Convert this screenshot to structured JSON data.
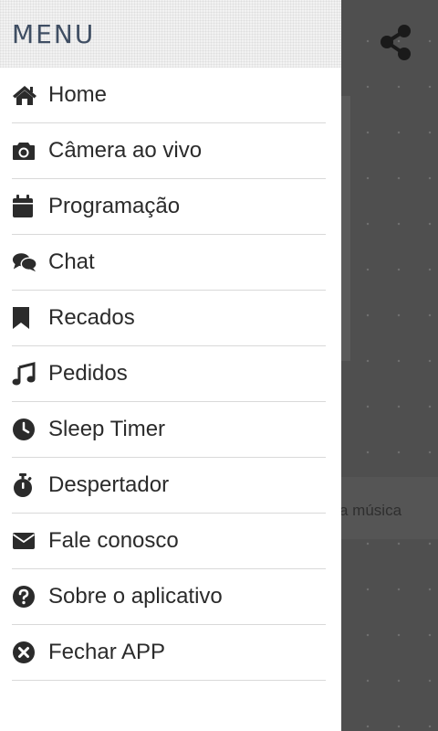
{
  "drawer": {
    "title": "MENU",
    "items": [
      {
        "label": "Home",
        "icon": "home-icon"
      },
      {
        "label": "Câmera ao vivo",
        "icon": "camera-icon"
      },
      {
        "label": "Programação",
        "icon": "calendar-icon"
      },
      {
        "label": "Chat",
        "icon": "chat-icon"
      },
      {
        "label": "Recados",
        "icon": "bookmark-icon"
      },
      {
        "label": "Pedidos",
        "icon": "music-icon"
      },
      {
        "label": "Sleep Timer",
        "icon": "clock-icon"
      },
      {
        "label": "Despertador",
        "icon": "stopwatch-icon"
      },
      {
        "label": "Fale conosco",
        "icon": "envelope-icon"
      },
      {
        "label": "Sobre o aplicativo",
        "icon": "question-icon"
      },
      {
        "label": "Fechar APP",
        "icon": "close-circle-icon"
      }
    ]
  },
  "background": {
    "music_text": "a música",
    "share_icon": "share-icon"
  },
  "colors": {
    "title": "#3f4e63",
    "text": "#2b2b2b",
    "divider": "#d9d9d9",
    "overlay": "#4f4f4f"
  }
}
